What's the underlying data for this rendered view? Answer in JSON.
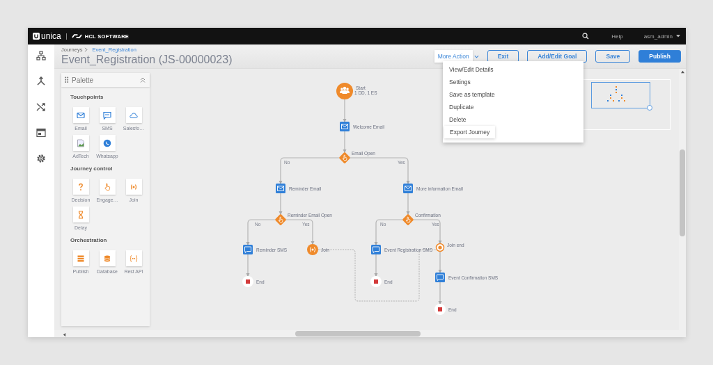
{
  "topbar": {
    "product": "unica",
    "company": "HCL SOFTWARE",
    "help": "Help",
    "user": "asm_admin"
  },
  "breadcrumb": {
    "parent": "Journeys",
    "current": "Event_Registration"
  },
  "title": "Event_Registration (JS-00000023)",
  "more_action": {
    "label": "More Action",
    "expanded": true
  },
  "buttons": [
    {
      "label": "Exit",
      "kind": "outline"
    },
    {
      "label": "Add/Edit Goal",
      "kind": "outline"
    },
    {
      "label": "Save",
      "kind": "outline"
    },
    {
      "label": "Publish",
      "kind": "primary"
    }
  ],
  "menu": [
    {
      "label": "View/Edit Details",
      "highlighted": false
    },
    {
      "label": "Settings",
      "highlighted": false
    },
    {
      "label": "Save as template",
      "highlighted": false
    },
    {
      "label": "Duplicate",
      "highlighted": false
    },
    {
      "label": "Delete",
      "highlighted": false
    },
    {
      "label": "Export Journey",
      "highlighted": true
    }
  ],
  "palette": {
    "title": "Palette",
    "sections": [
      {
        "title": "Touchpoints",
        "items": [
          {
            "label": "Email",
            "kind": "email"
          },
          {
            "label": "SMS",
            "kind": "sms"
          },
          {
            "label": "Salesfo…",
            "kind": "salesforce"
          },
          {
            "label": "AdTech",
            "kind": "adtech"
          },
          {
            "label": "Whatsapp",
            "kind": "whatsapp"
          }
        ]
      },
      {
        "title": "Journey control",
        "items": [
          {
            "label": "Decision",
            "kind": "decision"
          },
          {
            "label": "Engage…",
            "kind": "engagement"
          },
          {
            "label": "Join",
            "kind": "join"
          },
          {
            "label": "Delay",
            "kind": "delay"
          }
        ]
      },
      {
        "title": "Orchestration",
        "items": [
          {
            "label": "Publish",
            "kind": "publish"
          },
          {
            "label": "Database",
            "kind": "database"
          },
          {
            "label": "Rest API",
            "kind": "rest_api"
          }
        ]
      }
    ]
  },
  "journey": {
    "nodes": [
      {
        "kind": "start",
        "label": "Start",
        "detail": "1 DD, 1 ES"
      },
      {
        "kind": "email",
        "label": "Welcome Email"
      },
      {
        "kind": "decision",
        "label": "Email Open"
      },
      {
        "kind": "email",
        "label": "Reminder Email"
      },
      {
        "kind": "email",
        "label": "More information Email"
      },
      {
        "kind": "decision",
        "label": "Reminder Email Open"
      },
      {
        "kind": "decision",
        "label": "Confirmation"
      },
      {
        "kind": "sms",
        "label": "Reminder SMS"
      },
      {
        "kind": "join",
        "label": "Join"
      },
      {
        "kind": "sms",
        "label": "Event Registration SMS"
      },
      {
        "kind": "join_end",
        "label": "Join end"
      },
      {
        "kind": "end",
        "label": "End"
      },
      {
        "kind": "end",
        "label": "End"
      },
      {
        "kind": "sms",
        "label": "Event Confirmation SMS"
      },
      {
        "kind": "end",
        "label": "End"
      }
    ],
    "branch_labels": [
      "No",
      "Yes",
      "No",
      "Yes",
      "No",
      "Yes"
    ]
  }
}
